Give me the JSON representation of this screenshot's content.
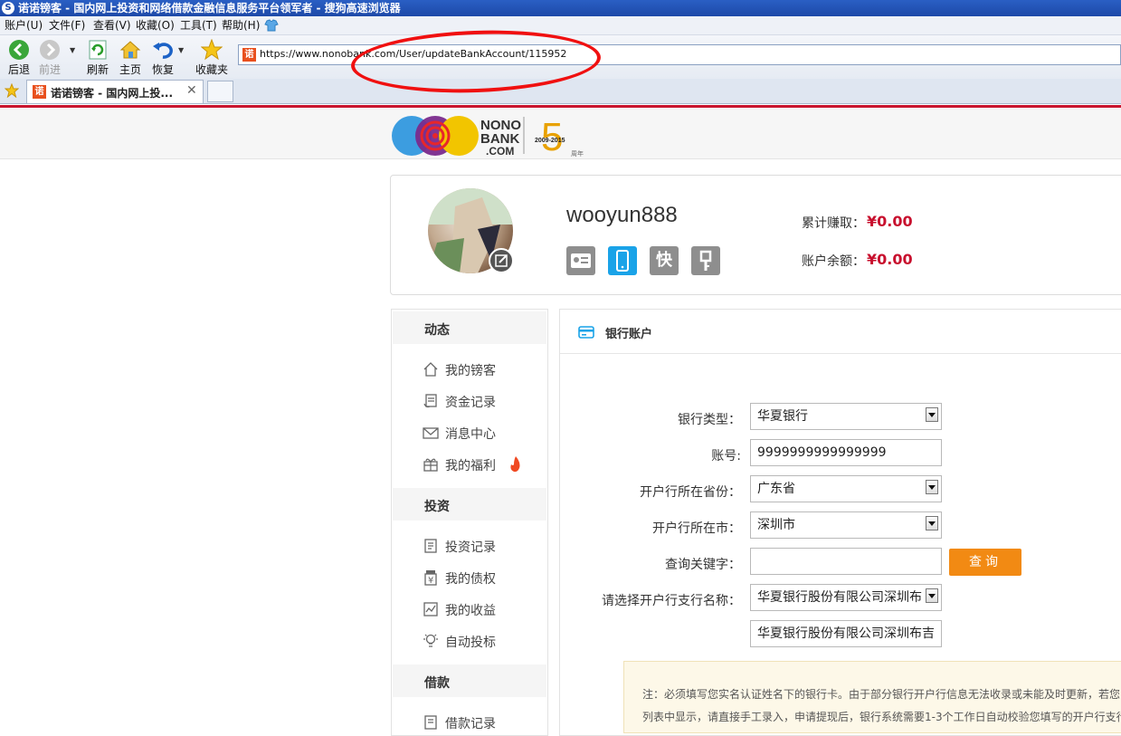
{
  "browser": {
    "window_title": "诺诺镑客 - 国内网上投资和网络借款金融信息服务平台领军者 - 搜狗高速浏览器",
    "menu": [
      "账户(U)",
      "文件(F)",
      "查看(V)",
      "收藏(O)",
      "工具(T)",
      "帮助(H)"
    ],
    "toolbar": {
      "back": "后退",
      "forward": "前进",
      "refresh": "刷新",
      "home": "主页",
      "restore": "恢复",
      "favorites": "收藏夹"
    },
    "address_url": "https://www.nonobank.com/User/updateBankAccount/115952",
    "tab_title": "诺诺镑客 - 国内网上投...",
    "favicon_char": "诺"
  },
  "header": {
    "logo_text_1": "NONO",
    "logo_text_2": "BANK",
    "logo_text_3": ".COM",
    "anniv_years": "2009-2015",
    "anniv_num": "5",
    "anniv_unit": "周年"
  },
  "profile": {
    "username": "wooyun888",
    "earned_label": "累计赚取：",
    "earned_value": "¥0.00",
    "balance_label": "账户余额：",
    "balance_value": "¥0.00",
    "badge_quick": "快"
  },
  "sidebar": {
    "sections": [
      {
        "title": "动态",
        "items": [
          "我的镑客",
          "资金记录",
          "消息中心",
          "我的福利"
        ]
      },
      {
        "title": "投资",
        "items": [
          "投资记录",
          "我的债权",
          "我的收益",
          "自动投标"
        ]
      },
      {
        "title": "借款",
        "items": [
          "借款记录"
        ]
      }
    ]
  },
  "panel": {
    "title": "银行账户",
    "form": {
      "bank_type_label": "银行类型：",
      "bank_type_value": "华夏银行",
      "account_label": "账号:",
      "account_value": "9999999999999999",
      "province_label": "开户行所在省份：",
      "province_value": "广东省",
      "city_label": "开户行所在市：",
      "city_value": "深圳市",
      "keyword_label": "查询关键字：",
      "keyword_value": "",
      "search_button": "查询",
      "branch_label": "请选择开户行支行名称：",
      "branch_value": "华夏银行股份有限公司深圳布",
      "branch_text_value": "华夏银行股份有限公司深圳布吉"
    },
    "notice_line1": "注：必须填写您实名认证姓名下的银行卡。由于部分银行开户行信息无法收录或未能及时更新，若您",
    "notice_line2": "列表中显示，请直接手工录入，申请提现后，银行系统需要1-3个工作日自动校验您填写的开户行支行"
  },
  "colors": {
    "accent_red": "#c8102e",
    "search_button": "#f28a13",
    "annotation_red": "#f01010"
  }
}
